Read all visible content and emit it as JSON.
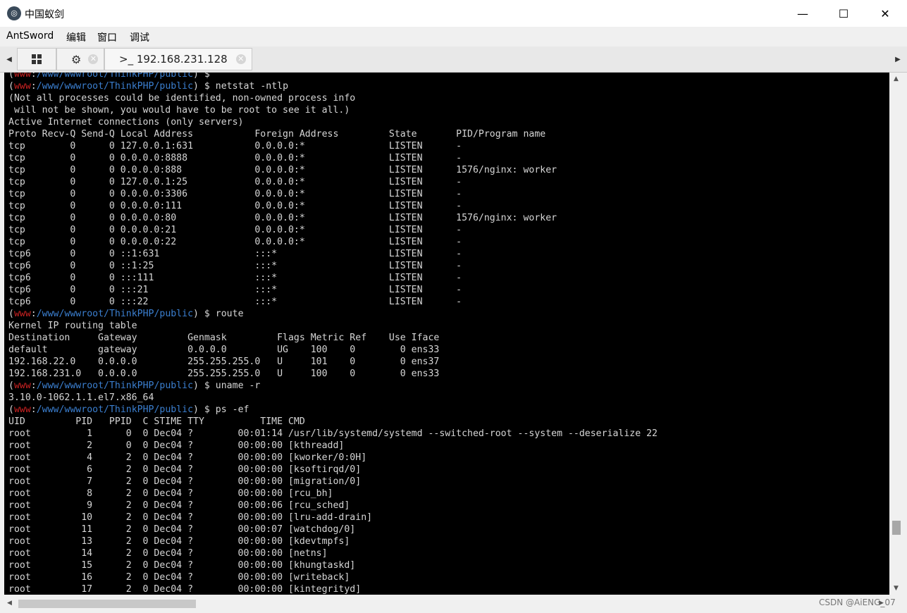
{
  "window": {
    "title": "中国蚁剑",
    "minimize_glyph": "—",
    "maximize_glyph": "☐",
    "close_glyph": "✕"
  },
  "menu": [
    "AntSword",
    "编辑",
    "窗口",
    "调试"
  ],
  "tabs": {
    "home_icon": "grid-icon",
    "settings_icon": "gear-icon",
    "shell_tab_label": ">_ 192.168.231.128"
  },
  "terminal": {
    "prompt": {
      "user": "www",
      "path": "/www/wwwroot/ThinkPHP/public"
    },
    "lines": [
      {
        "t": "prompt",
        "cmd": "$ "
      },
      {
        "t": "prompt",
        "cmd": "$ netstat -ntlp"
      },
      {
        "t": "text",
        "s": "(Not all processes could be identified, non-owned process info"
      },
      {
        "t": "text",
        "s": " will not be shown, you would have to be root to see it all.)"
      },
      {
        "t": "text",
        "s": "Active Internet connections (only servers)"
      },
      {
        "t": "text",
        "s": "Proto Recv-Q Send-Q Local Address           Foreign Address         State       PID/Program name"
      },
      {
        "t": "text",
        "s": "tcp        0      0 127.0.0.1:631           0.0.0.0:*               LISTEN      -"
      },
      {
        "t": "text",
        "s": "tcp        0      0 0.0.0.0:8888            0.0.0.0:*               LISTEN      -"
      },
      {
        "t": "text",
        "s": "tcp        0      0 0.0.0.0:888             0.0.0.0:*               LISTEN      1576/nginx: worker"
      },
      {
        "t": "text",
        "s": "tcp        0      0 127.0.0.1:25            0.0.0.0:*               LISTEN      -"
      },
      {
        "t": "text",
        "s": "tcp        0      0 0.0.0.0:3306            0.0.0.0:*               LISTEN      -"
      },
      {
        "t": "text",
        "s": "tcp        0      0 0.0.0.0:111             0.0.0.0:*               LISTEN      -"
      },
      {
        "t": "text",
        "s": "tcp        0      0 0.0.0.0:80              0.0.0.0:*               LISTEN      1576/nginx: worker"
      },
      {
        "t": "text",
        "s": "tcp        0      0 0.0.0.0:21              0.0.0.0:*               LISTEN      -"
      },
      {
        "t": "text",
        "s": "tcp        0      0 0.0.0.0:22              0.0.0.0:*               LISTEN      -"
      },
      {
        "t": "text",
        "s": "tcp6       0      0 ::1:631                 :::*                    LISTEN      -"
      },
      {
        "t": "text",
        "s": "tcp6       0      0 ::1:25                  :::*                    LISTEN      -"
      },
      {
        "t": "text",
        "s": "tcp6       0      0 :::111                  :::*                    LISTEN      -"
      },
      {
        "t": "text",
        "s": "tcp6       0      0 :::21                   :::*                    LISTEN      -"
      },
      {
        "t": "text",
        "s": "tcp6       0      0 :::22                   :::*                    LISTEN      -"
      },
      {
        "t": "prompt",
        "cmd": "$ route"
      },
      {
        "t": "text",
        "s": "Kernel IP routing table"
      },
      {
        "t": "text",
        "s": "Destination     Gateway         Genmask         Flags Metric Ref    Use Iface"
      },
      {
        "t": "text",
        "s": "default         gateway         0.0.0.0         UG    100    0        0 ens33"
      },
      {
        "t": "text",
        "s": "192.168.22.0    0.0.0.0         255.255.255.0   U     101    0        0 ens37"
      },
      {
        "t": "text",
        "s": "192.168.231.0   0.0.0.0         255.255.255.0   U     100    0        0 ens33"
      },
      {
        "t": "prompt",
        "cmd": "$ uname -r"
      },
      {
        "t": "text",
        "s": "3.10.0-1062.1.1.el7.x86_64"
      },
      {
        "t": "prompt",
        "cmd": "$ ps -ef"
      },
      {
        "t": "text",
        "s": "UID         PID   PPID  C STIME TTY          TIME CMD"
      },
      {
        "t": "text",
        "s": "root          1      0  0 Dec04 ?        00:01:14 /usr/lib/systemd/systemd --switched-root --system --deserialize 22"
      },
      {
        "t": "text",
        "s": "root          2      0  0 Dec04 ?        00:00:00 [kthreadd]"
      },
      {
        "t": "text",
        "s": "root          4      2  0 Dec04 ?        00:00:00 [kworker/0:0H]"
      },
      {
        "t": "text",
        "s": "root          6      2  0 Dec04 ?        00:00:00 [ksoftirqd/0]"
      },
      {
        "t": "text",
        "s": "root          7      2  0 Dec04 ?        00:00:00 [migration/0]"
      },
      {
        "t": "text",
        "s": "root          8      2  0 Dec04 ?        00:00:00 [rcu_bh]"
      },
      {
        "t": "text",
        "s": "root          9      2  0 Dec04 ?        00:00:06 [rcu_sched]"
      },
      {
        "t": "text",
        "s": "root         10      2  0 Dec04 ?        00:00:00 [lru-add-drain]"
      },
      {
        "t": "text",
        "s": "root         11      2  0 Dec04 ?        00:00:07 [watchdog/0]"
      },
      {
        "t": "text",
        "s": "root         13      2  0 Dec04 ?        00:00:00 [kdevtmpfs]"
      },
      {
        "t": "text",
        "s": "root         14      2  0 Dec04 ?        00:00:00 [netns]"
      },
      {
        "t": "text",
        "s": "root         15      2  0 Dec04 ?        00:00:00 [khungtaskd]"
      },
      {
        "t": "text",
        "s": "root         16      2  0 Dec04 ?        00:00:00 [writeback]"
      },
      {
        "t": "text",
        "s": "root         17      2  0 Dec04 ?        00:00:00 [kintegrityd]"
      }
    ]
  },
  "watermark": "CSDN @AiENG_07",
  "colors": {
    "prompt_user": "#cc2222",
    "prompt_path": "#3b7fd0",
    "terminal_bg": "#000000",
    "terminal_fg": "#d6d6d6"
  }
}
